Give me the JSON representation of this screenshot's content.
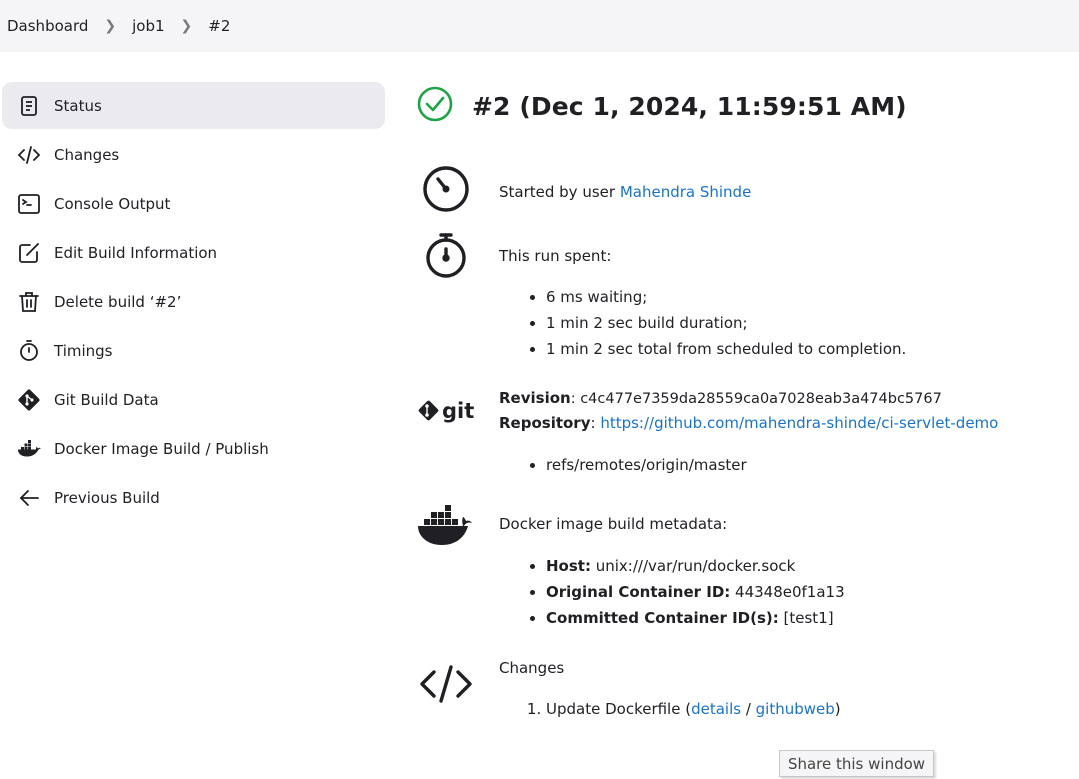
{
  "breadcrumb": {
    "items": [
      "Dashboard",
      "job1",
      "#2"
    ]
  },
  "sidebar": {
    "items": [
      {
        "label": "Status",
        "icon": "document-icon",
        "active": true
      },
      {
        "label": "Changes",
        "icon": "code-icon"
      },
      {
        "label": "Console Output",
        "icon": "terminal-icon"
      },
      {
        "label": "Edit Build Information",
        "icon": "edit-icon"
      },
      {
        "label": "Delete build ‘#2’",
        "icon": "trash-icon"
      },
      {
        "label": "Timings",
        "icon": "stopwatch-icon"
      },
      {
        "label": "Git Build Data",
        "icon": "git-icon"
      },
      {
        "label": "Docker Image Build / Publish",
        "icon": "docker-icon"
      },
      {
        "label": "Previous Build",
        "icon": "arrow-left-icon"
      }
    ]
  },
  "main": {
    "title": "#2 (Dec 1, 2024, 11:59:51 AM)",
    "status_color": "#1ea446",
    "started": {
      "prefix": "Started by user ",
      "user": "Mahendra Shinde"
    },
    "spent": {
      "heading": "This run spent:",
      "items": [
        "6 ms waiting;",
        "1 min 2 sec build duration;",
        "1 min 2 sec total from scheduled to completion."
      ]
    },
    "git": {
      "icon_text": "git",
      "revision_label": "Revision",
      "revision": ": c4c477e7359da28559ca0a7028eab3a474bc5767",
      "repository_label": "Repository",
      "repository_sep": ": ",
      "repository_url": "https://github.com/mahendra-shinde/ci-servlet-demo",
      "branches": [
        "refs/remotes/origin/master"
      ]
    },
    "docker": {
      "heading": "Docker image build metadata:",
      "host_label": "Host:",
      "host_value": " unix:///var/run/docker.sock",
      "container_label": "Original Container ID:",
      "container_value": " 44348e0f1a13",
      "committed_label": "Committed Container ID(s):",
      "committed_value": " [test1]"
    },
    "changes": {
      "heading": "Changes",
      "item_text": "Update Dockerfile (",
      "details_link": "details",
      "sep": " / ",
      "githubweb_link": "githubweb",
      "close": ")"
    }
  },
  "tooltip": "Share this window",
  "colors": {
    "accent": "#1a73c8",
    "success": "#1ea446",
    "topbar": "#f5f5f7"
  }
}
